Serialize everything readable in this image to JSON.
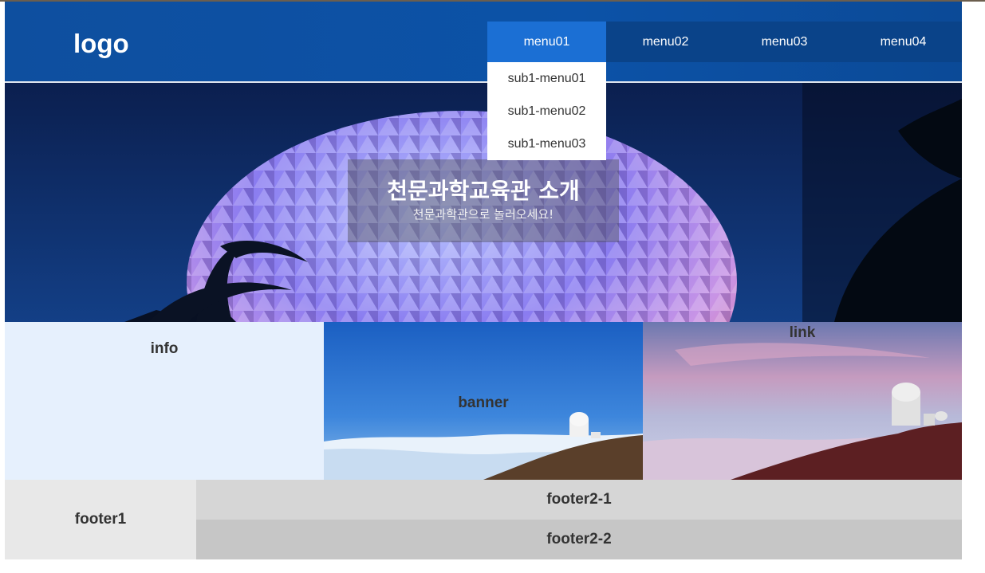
{
  "header": {
    "logo": "logo",
    "menus": [
      "menu01",
      "menu02",
      "menu03",
      "menu04"
    ],
    "active_menu": "menu01",
    "submenu": [
      "sub1-menu01",
      "sub1-menu02",
      "sub1-menu03"
    ]
  },
  "hero": {
    "title": "천문과학교육관 소개",
    "subtitle": "천문과학관으로 놀러오세요!"
  },
  "content": {
    "info": "info",
    "banner": "banner",
    "link": "link"
  },
  "footer": {
    "footer1": "footer1",
    "footer2_1": "footer2-1",
    "footer2_2": "footer2-2"
  },
  "colors": {
    "header_bg": "#0c52a7",
    "menu_bar": "#0a4389",
    "menu_active": "#1b6fd4",
    "info_bg": "#e6f0fd",
    "footer1_bg": "#e8e8e8",
    "footer2_1_bg": "#d6d6d6",
    "footer2_2_bg": "#c6c6c6"
  }
}
